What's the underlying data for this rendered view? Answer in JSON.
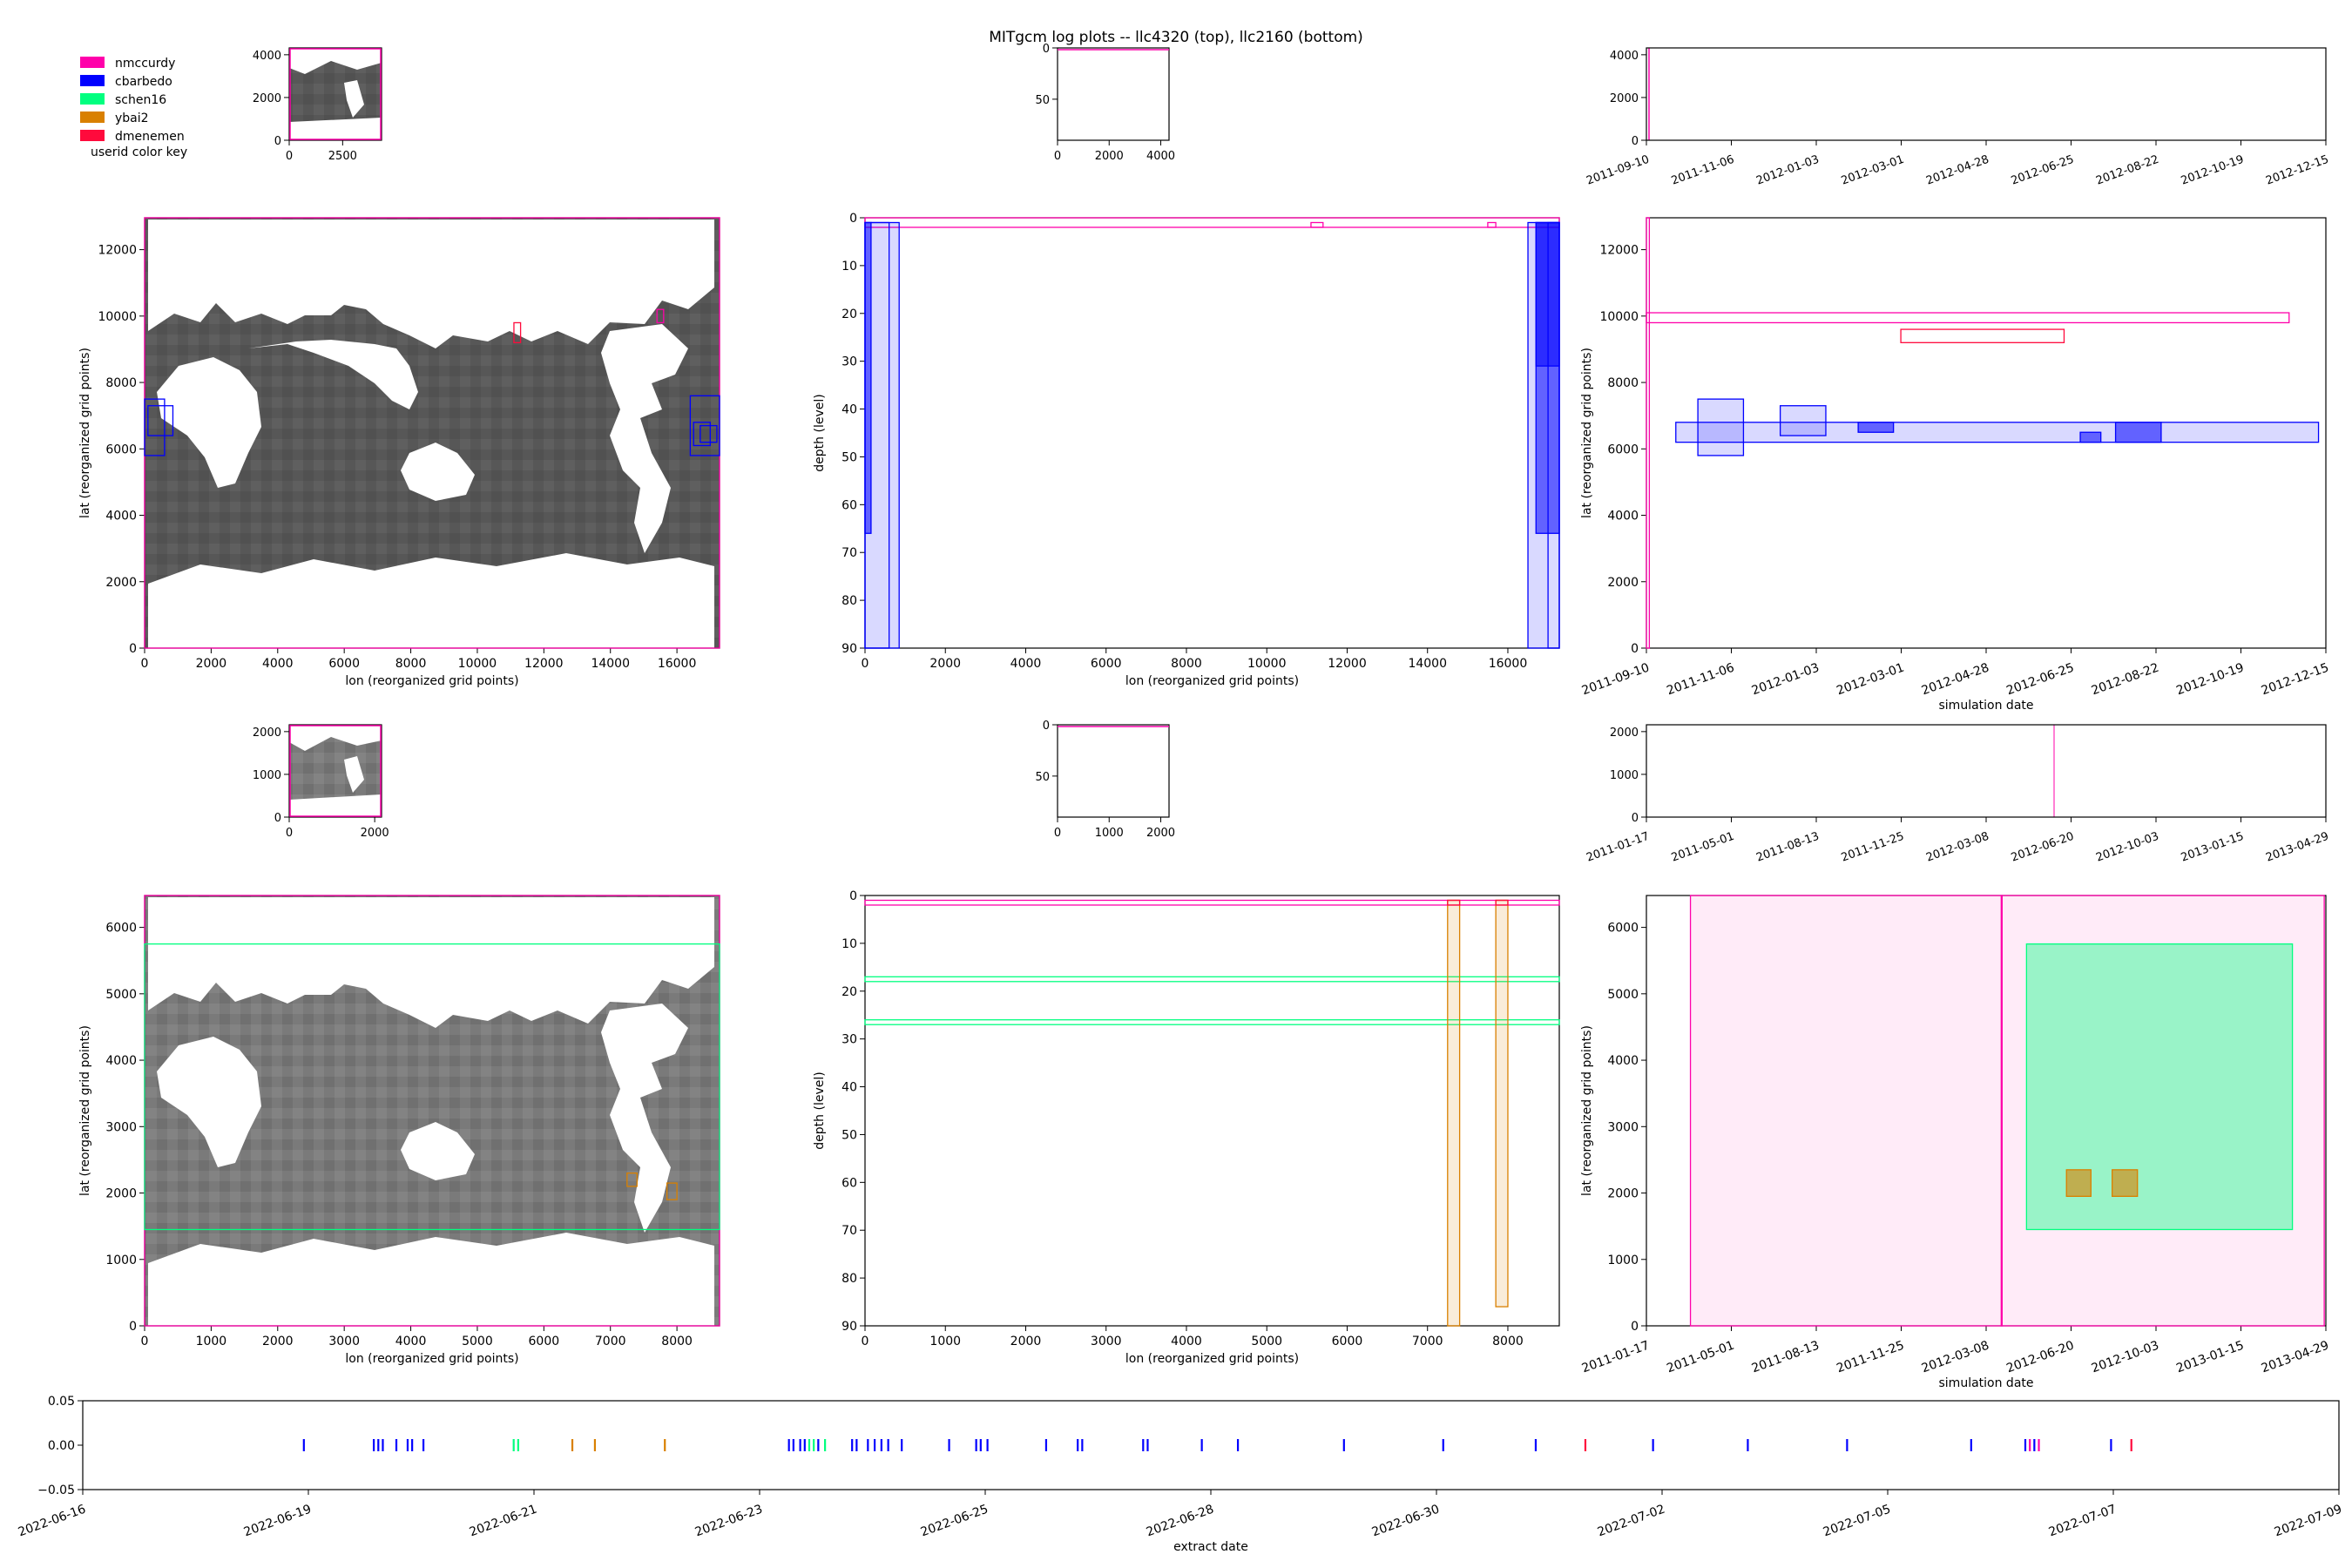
{
  "figure_title": "MITgcm log plots -- llc4320 (top), llc2160 (bottom)",
  "legend": {
    "caption": "userid color key",
    "entries": [
      {
        "label": "nmccurdy",
        "color": "#ff00aa"
      },
      {
        "label": "cbarbedo",
        "color": "#0000ff"
      },
      {
        "label": "schen16",
        "color": "#00ff7f"
      },
      {
        "label": "ybai2",
        "color": "#d98000"
      },
      {
        "label": "dmenemen",
        "color": "#ff0a3c"
      }
    ]
  },
  "chart_data": [
    {
      "id": "llc4320-mini-map",
      "type": "heatmap",
      "xticks": [
        "0",
        "2500"
      ],
      "yticks": [
        "0",
        "2000",
        "4000"
      ],
      "xlim": [
        0,
        4320
      ],
      "ylim": [
        0,
        4320
      ]
    },
    {
      "id": "llc4320-mini-depth",
      "type": "bar",
      "xticks": [
        "0",
        "2000",
        "4000"
      ],
      "yticks": [
        "0",
        "50"
      ],
      "xlim": [
        0,
        4320
      ],
      "ylim": [
        90,
        0
      ]
    },
    {
      "id": "llc4320-mini-time",
      "type": "bar",
      "xticks": [
        "2011-09-10",
        "2011-11-06",
        "2012-01-03",
        "2012-03-01",
        "2012-04-28",
        "2012-06-25",
        "2012-08-22",
        "2012-10-19",
        "2012-12-15"
      ],
      "yticks": [
        "0",
        "2000",
        "4000"
      ],
      "ylim": [
        0,
        4320
      ]
    },
    {
      "id": "llc4320-map",
      "type": "heatmap",
      "xlabel": "lon (reorganized grid points)",
      "ylabel": "lat (reorganized grid points)",
      "xticks": [
        "0",
        "2000",
        "4000",
        "6000",
        "8000",
        "10000",
        "12000",
        "14000",
        "16000"
      ],
      "yticks": [
        "0",
        "2000",
        "4000",
        "6000",
        "8000",
        "10000",
        "12000"
      ],
      "xlim": [
        0,
        17280
      ],
      "ylim": [
        0,
        12960
      ],
      "boxes": [
        {
          "user": "nmccurdy",
          "x0": 0,
          "x1": 17280,
          "y0": 0,
          "y1": 12960
        },
        {
          "user": "dmenemen",
          "x0": 11100,
          "x1": 11300,
          "y0": 9200,
          "y1": 9800
        },
        {
          "user": "nmccurdy",
          "x0": 15400,
          "x1": 15600,
          "y0": 9800,
          "y1": 10200
        },
        {
          "user": "cbarbedo",
          "x0": 0,
          "x1": 600,
          "y0": 5800,
          "y1": 7500
        },
        {
          "user": "cbarbedo",
          "x0": 100,
          "x1": 850,
          "y0": 6400,
          "y1": 7300
        },
        {
          "user": "cbarbedo",
          "x0": 16400,
          "x1": 17280,
          "y0": 5800,
          "y1": 7600
        },
        {
          "user": "cbarbedo",
          "x0": 16500,
          "x1": 17000,
          "y0": 6100,
          "y1": 6800
        },
        {
          "user": "cbarbedo",
          "x0": 16700,
          "x1": 17200,
          "y0": 6200,
          "y1": 6700
        }
      ]
    },
    {
      "id": "llc4320-depth",
      "type": "bar",
      "xlabel": "lon (reorganized grid points)",
      "ylabel": "depth (level)",
      "xticks": [
        "0",
        "2000",
        "4000",
        "6000",
        "8000",
        "10000",
        "12000",
        "14000",
        "16000"
      ],
      "yticks": [
        "0",
        "10",
        "20",
        "30",
        "40",
        "50",
        "60",
        "70",
        "80",
        "90"
      ],
      "xlim": [
        0,
        17280
      ],
      "ylim": [
        90,
        0
      ],
      "boxes": [
        {
          "user": "nmccurdy",
          "x0": 0,
          "x1": 17280,
          "y0": 0,
          "y1": 2
        },
        {
          "user": "nmccurdy",
          "x0": 11100,
          "x1": 11400,
          "y0": 1,
          "y1": 2
        },
        {
          "user": "nmccurdy",
          "x0": 15500,
          "x1": 15700,
          "y0": 1,
          "y1": 2
        },
        {
          "user": "cbarbedo",
          "x0": 0,
          "x1": 850,
          "y0": 1,
          "y1": 90,
          "fill": true
        },
        {
          "user": "cbarbedo",
          "x0": 0,
          "x1": 150,
          "y0": 1,
          "y1": 66,
          "fill": true,
          "dark": true
        },
        {
          "user": "cbarbedo",
          "x0": 0,
          "x1": 600,
          "y0": 1,
          "y1": 90
        },
        {
          "user": "cbarbedo",
          "x0": 16500,
          "x1": 17280,
          "y0": 1,
          "y1": 90,
          "fill": true
        },
        {
          "user": "cbarbedo",
          "x0": 16700,
          "x1": 17280,
          "y0": 1,
          "y1": 31,
          "fill": true,
          "dark": true
        },
        {
          "user": "cbarbedo",
          "x0": 16700,
          "x1": 17280,
          "y0": 1,
          "y1": 66,
          "fill": true,
          "dark": true
        },
        {
          "user": "cbarbedo",
          "x0": 17000,
          "x1": 17280,
          "y0": 1,
          "y1": 90
        }
      ]
    },
    {
      "id": "llc4320-time",
      "type": "bar",
      "xlabel": "simulation date",
      "ylabel": "lat (reorganized grid points)",
      "xticks": [
        "2011-09-10",
        "2011-11-06",
        "2012-01-03",
        "2012-03-01",
        "2012-04-28",
        "2012-06-25",
        "2012-08-22",
        "2012-10-19",
        "2012-12-15"
      ],
      "yticks": [
        "0",
        "2000",
        "4000",
        "6000",
        "8000",
        "10000",
        "12000"
      ],
      "xlim": [
        "2011-09-10",
        "2012-12-15"
      ],
      "ylim": [
        0,
        12960
      ],
      "boxes": [
        {
          "user": "nmccurdy",
          "x0": "2011-09-10",
          "x1": "2011-09-12",
          "y0": 0,
          "y1": 12960
        },
        {
          "user": "nmccurdy",
          "x0": "2011-09-10",
          "x1": "2012-11-20",
          "y0": 9800,
          "y1": 10100
        },
        {
          "user": "dmenemen",
          "x0": "2012-03-01",
          "x1": "2012-06-20",
          "y0": 9200,
          "y1": 9600
        },
        {
          "user": "cbarbedo",
          "x0": "2011-09-30",
          "x1": "2012-12-10",
          "y0": 6200,
          "y1": 6800,
          "fill": true
        },
        {
          "user": "cbarbedo",
          "x0": "2011-10-15",
          "x1": "2011-11-15",
          "y0": 5800,
          "y1": 7500,
          "fill": true
        },
        {
          "user": "cbarbedo",
          "x0": "2011-12-10",
          "x1": "2012-01-10",
          "y0": 6400,
          "y1": 7300,
          "fill": true
        },
        {
          "user": "cbarbedo",
          "x0": "2012-02-01",
          "x1": "2012-02-25",
          "y0": 6500,
          "y1": 6800,
          "fill": true,
          "dark": true
        },
        {
          "user": "cbarbedo",
          "x0": "2012-07-01",
          "x1": "2012-07-15",
          "y0": 6200,
          "y1": 6500,
          "fill": true,
          "dark": true
        },
        {
          "user": "cbarbedo",
          "x0": "2012-07-25",
          "x1": "2012-08-25",
          "y0": 6200,
          "y1": 6800,
          "fill": true,
          "dark": true
        }
      ]
    },
    {
      "id": "llc2160-mini-map",
      "type": "heatmap",
      "xticks": [
        "0",
        "2000"
      ],
      "yticks": [
        "0",
        "1000",
        "2000"
      ],
      "xlim": [
        0,
        2160
      ],
      "ylim": [
        0,
        2160
      ]
    },
    {
      "id": "llc2160-mini-depth",
      "type": "bar",
      "xticks": [
        "0",
        "1000",
        "2000"
      ],
      "yticks": [
        "0",
        "50"
      ],
      "xlim": [
        0,
        2160
      ],
      "ylim": [
        90,
        0
      ]
    },
    {
      "id": "llc2160-mini-time",
      "type": "bar",
      "xticks": [
        "2011-01-17",
        "2011-05-01",
        "2011-08-13",
        "2011-11-25",
        "2012-03-08",
        "2012-06-20",
        "2012-10-03",
        "2013-01-15",
        "2013-04-29"
      ],
      "yticks": [
        "0",
        "1000",
        "2000"
      ],
      "ylim": [
        0,
        2160
      ]
    },
    {
      "id": "llc2160-map",
      "type": "heatmap",
      "xlabel": "lon (reorganized grid points)",
      "ylabel": "lat (reorganized grid points)",
      "xticks": [
        "0",
        "1000",
        "2000",
        "3000",
        "4000",
        "5000",
        "6000",
        "7000",
        "8000"
      ],
      "yticks": [
        "0",
        "1000",
        "2000",
        "3000",
        "4000",
        "5000",
        "6000"
      ],
      "xlim": [
        0,
        8640
      ],
      "ylim": [
        0,
        6480
      ],
      "boxes": [
        {
          "user": "nmccurdy",
          "x0": 0,
          "x1": 8640,
          "y0": 0,
          "y1": 6480
        },
        {
          "user": "schen16",
          "x0": 0,
          "x1": 8640,
          "y0": 1450,
          "y1": 5750
        },
        {
          "user": "ybai2",
          "x0": 7250,
          "x1": 7400,
          "y0": 2100,
          "y1": 2300
        },
        {
          "user": "ybai2",
          "x0": 7850,
          "x1": 8000,
          "y0": 1900,
          "y1": 2150
        }
      ]
    },
    {
      "id": "llc2160-depth",
      "type": "bar",
      "xlabel": "lon (reorganized grid points)",
      "ylabel": "depth (level)",
      "xticks": [
        "0",
        "1000",
        "2000",
        "3000",
        "4000",
        "5000",
        "6000",
        "7000",
        "8000"
      ],
      "yticks": [
        "0",
        "10",
        "20",
        "30",
        "40",
        "50",
        "60",
        "70",
        "80",
        "90"
      ],
      "xlim": [
        0,
        8640
      ],
      "ylim": [
        90,
        0
      ],
      "boxes": [
        {
          "user": "nmccurdy",
          "x0": 0,
          "x1": 8640,
          "y0": 1,
          "y1": 2
        },
        {
          "user": "schen16",
          "x0": 0,
          "x1": 8640,
          "y0": 17,
          "y1": 18
        },
        {
          "user": "schen16",
          "x0": 0,
          "x1": 8640,
          "y0": 26,
          "y1": 27
        },
        {
          "user": "ybai2",
          "x0": 7250,
          "x1": 7400,
          "y0": 1,
          "y1": 90,
          "fill": true
        },
        {
          "user": "ybai2",
          "x0": 7850,
          "x1": 8000,
          "y0": 1,
          "y1": 86,
          "fill": true
        },
        {
          "user": "dmenemen",
          "x0": 7250,
          "x1": 7400,
          "y0": 1,
          "y1": 2
        },
        {
          "user": "dmenemen",
          "x0": 7850,
          "x1": 8000,
          "y0": 1,
          "y1": 2
        }
      ]
    },
    {
      "id": "llc2160-time",
      "type": "bar",
      "xlabel": "simulation date",
      "ylabel": "lat (reorganized grid points)",
      "xticks": [
        "2011-01-17",
        "2011-05-01",
        "2011-08-13",
        "2011-11-25",
        "2012-03-08",
        "2012-06-20",
        "2012-10-03",
        "2013-01-15",
        "2013-04-29"
      ],
      "yticks": [
        "0",
        "1000",
        "2000",
        "3000",
        "4000",
        "5000",
        "6000"
      ],
      "xlim": [
        "2011-01-17",
        "2013-04-29"
      ],
      "ylim": [
        0,
        6480
      ],
      "boxes": [
        {
          "user": "nmccurdy",
          "x0": "2011-03-12",
          "x1": "2013-04-27",
          "y0": 0,
          "y1": 6480,
          "fill": true,
          "alpha": 0.08
        },
        {
          "user": "nmccurdy",
          "x0": "2012-03-27",
          "x1": "2012-03-28",
          "y0": 0,
          "y1": 6480
        },
        {
          "user": "schen16",
          "x0": "2012-04-27",
          "x1": "2013-03-19",
          "y0": 1450,
          "y1": 5750,
          "fill": true,
          "alpha": 0.4
        },
        {
          "user": "ybai2",
          "x0": "2012-06-15",
          "x1": "2012-07-15",
          "y0": 1950,
          "y1": 2350,
          "fill": true,
          "alpha": 0.6
        },
        {
          "user": "ybai2",
          "x0": "2012-08-10",
          "x1": "2012-09-10",
          "y0": 1950,
          "y1": 2350,
          "fill": true,
          "alpha": 0.6
        }
      ]
    },
    {
      "id": "extract-timeline",
      "type": "scatter",
      "xlabel": "extract date",
      "xticks": [
        "2022-06-16",
        "2022-06-19",
        "2022-06-21",
        "2022-06-23",
        "2022-06-25",
        "2022-06-28",
        "2022-06-30",
        "2022-07-02",
        "2022-07-05",
        "2022-07-07",
        "2022-07-09"
      ],
      "yticks": [
        "0.05",
        "0.00",
        "−0.05"
      ],
      "ylim": [
        -0.05,
        0.05
      ],
      "events": [
        {
          "t": 0.098,
          "user": "cbarbedo"
        },
        {
          "t": 0.129,
          "user": "cbarbedo"
        },
        {
          "t": 0.131,
          "user": "cbarbedo"
        },
        {
          "t": 0.133,
          "user": "cbarbedo"
        },
        {
          "t": 0.139,
          "user": "cbarbedo"
        },
        {
          "t": 0.144,
          "user": "cbarbedo"
        },
        {
          "t": 0.146,
          "user": "cbarbedo"
        },
        {
          "t": 0.151,
          "user": "cbarbedo"
        },
        {
          "t": 0.191,
          "user": "schen16"
        },
        {
          "t": 0.193,
          "user": "schen16"
        },
        {
          "t": 0.217,
          "user": "ybai2"
        },
        {
          "t": 0.227,
          "user": "ybai2"
        },
        {
          "t": 0.258,
          "user": "ybai2"
        },
        {
          "t": 0.313,
          "user": "cbarbedo"
        },
        {
          "t": 0.315,
          "user": "cbarbedo"
        },
        {
          "t": 0.318,
          "user": "cbarbedo"
        },
        {
          "t": 0.32,
          "user": "cbarbedo"
        },
        {
          "t": 0.322,
          "user": "schen16"
        },
        {
          "t": 0.324,
          "user": "schen16"
        },
        {
          "t": 0.326,
          "user": "cbarbedo"
        },
        {
          "t": 0.329,
          "user": "schen16"
        },
        {
          "t": 0.341,
          "user": "cbarbedo"
        },
        {
          "t": 0.343,
          "user": "cbarbedo"
        },
        {
          "t": 0.348,
          "user": "cbarbedo"
        },
        {
          "t": 0.351,
          "user": "cbarbedo"
        },
        {
          "t": 0.354,
          "user": "cbarbedo"
        },
        {
          "t": 0.357,
          "user": "cbarbedo"
        },
        {
          "t": 0.363,
          "user": "cbarbedo"
        },
        {
          "t": 0.384,
          "user": "cbarbedo"
        },
        {
          "t": 0.396,
          "user": "cbarbedo"
        },
        {
          "t": 0.398,
          "user": "cbarbedo"
        },
        {
          "t": 0.401,
          "user": "cbarbedo"
        },
        {
          "t": 0.427,
          "user": "cbarbedo"
        },
        {
          "t": 0.441,
          "user": "cbarbedo"
        },
        {
          "t": 0.443,
          "user": "cbarbedo"
        },
        {
          "t": 0.47,
          "user": "cbarbedo"
        },
        {
          "t": 0.472,
          "user": "cbarbedo"
        },
        {
          "t": 0.496,
          "user": "cbarbedo"
        },
        {
          "t": 0.512,
          "user": "cbarbedo"
        },
        {
          "t": 0.559,
          "user": "cbarbedo"
        },
        {
          "t": 0.603,
          "user": "cbarbedo"
        },
        {
          "t": 0.644,
          "user": "cbarbedo"
        },
        {
          "t": 0.666,
          "user": "dmenemen"
        },
        {
          "t": 0.696,
          "user": "cbarbedo"
        },
        {
          "t": 0.738,
          "user": "cbarbedo"
        },
        {
          "t": 0.782,
          "user": "cbarbedo"
        },
        {
          "t": 0.837,
          "user": "cbarbedo"
        },
        {
          "t": 0.861,
          "user": "cbarbedo"
        },
        {
          "t": 0.863,
          "user": "nmccurdy"
        },
        {
          "t": 0.865,
          "user": "cbarbedo"
        },
        {
          "t": 0.867,
          "user": "nmccurdy"
        },
        {
          "t": 0.899,
          "user": "cbarbedo"
        },
        {
          "t": 0.908,
          "user": "dmenemen"
        }
      ]
    }
  ]
}
